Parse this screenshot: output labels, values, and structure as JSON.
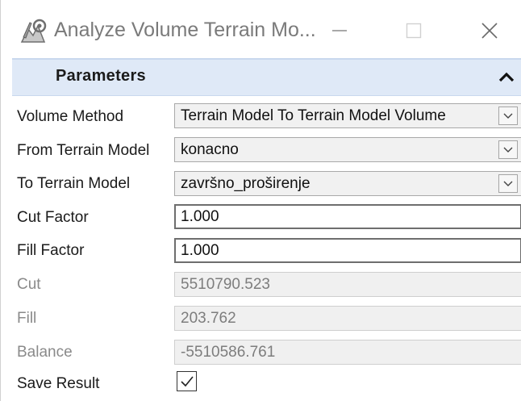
{
  "window": {
    "title": "Analyze Volume Terrain Mo...",
    "icon": "terrain-tool-icon",
    "controls": [
      "minimize-icon",
      "maximize-icon",
      "close-icon"
    ]
  },
  "section": {
    "title": "Parameters",
    "collapse_icon": "chevron-up-icon"
  },
  "rows": {
    "volume_method": {
      "label": "Volume Method",
      "value": "Terrain Model To Terrain Model Volume"
    },
    "from_terrain": {
      "label": "From Terrain Model",
      "value": "konacno"
    },
    "to_terrain": {
      "label": "To Terrain Model",
      "value": "završno_proširenje"
    },
    "cut_factor": {
      "label": "Cut Factor",
      "value": "1.000"
    },
    "fill_factor": {
      "label": "Fill Factor",
      "value": "1.000"
    },
    "cut": {
      "label": "Cut",
      "value": "5510790.523"
    },
    "fill": {
      "label": "Fill",
      "value": "203.762"
    },
    "balance": {
      "label": "Balance",
      "value": "-5510586.761"
    },
    "save_result": {
      "label": "Save Result",
      "checked": true
    }
  },
  "colors": {
    "section_header_bg": "#dfe9f7",
    "disabled_text": "#8a8a8a"
  }
}
